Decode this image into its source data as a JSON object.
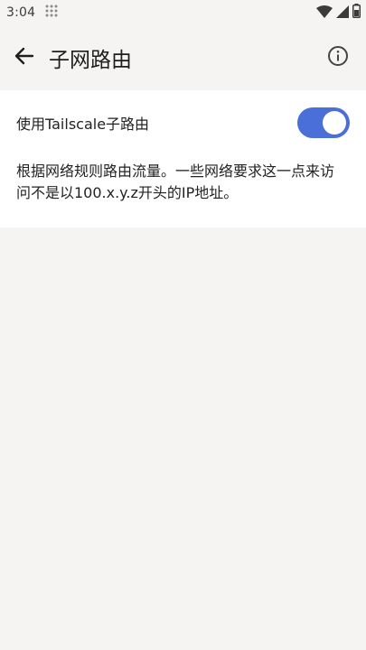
{
  "status_bar": {
    "time": "3:04",
    "icons": [
      "dots-grid-icon",
      "wifi-icon",
      "cell-signal-icon",
      "battery-icon"
    ]
  },
  "app_bar": {
    "title": "子网路由",
    "back_icon": "arrow-left-icon",
    "info_icon": "info-icon"
  },
  "settings": {
    "toggle_label": "使用Tailscale子路由",
    "toggle_on": true,
    "description": "根据网络规则路由流量。一些网络要求这一点来访问不是以100.x.y.z开头的IP地址。"
  },
  "colors": {
    "accent": "#4a6fd8",
    "background": "#f5f4f2",
    "card": "#ffffff"
  }
}
